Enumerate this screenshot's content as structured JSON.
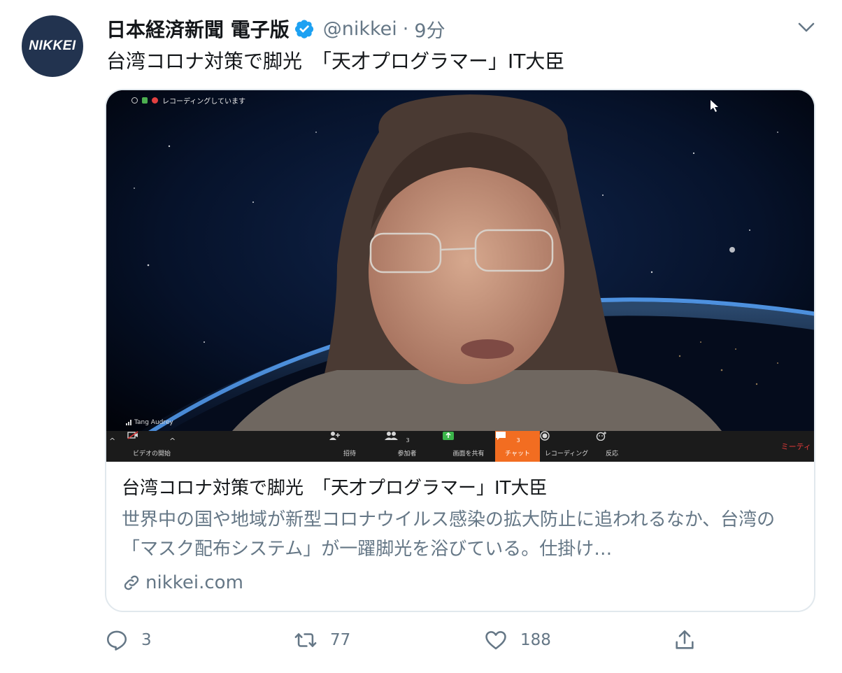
{
  "tweet": {
    "avatar_text": "NIKKEI",
    "display_name": "日本経済新聞 電子版",
    "handle": "@nikkei",
    "separator": "·",
    "time": "9分",
    "text": "台湾コロナ対策で脚光　「天才プログラマー」IT大臣"
  },
  "card": {
    "title": "台湾コロナ対策で脚光　「天才プログラマー」IT大臣",
    "description": "世界中の国や地域が新型コロナウイルス感染の拡大防止に追われるなか、台湾の「マスク配布システム」が一躍脚光を浴びている。仕掛け…",
    "domain": "nikkei.com",
    "media": {
      "recording_label": "レコーディングしています",
      "participant_name": "Tang Audrey",
      "toolbar": {
        "video": "ビデオの開始",
        "invite": "招待",
        "participants": "参加者",
        "participants_count": "3",
        "share": "画面を共有",
        "chat": "チャット",
        "chat_count": "3",
        "record": "レコーディング",
        "reactions": "反応",
        "end": "ミーティ"
      }
    }
  },
  "actions": {
    "reply_count": "3",
    "retweet_count": "77",
    "like_count": "188"
  },
  "colors": {
    "verified": "#1da1f2",
    "secondary_text": "#657786",
    "border": "#e1e8ed",
    "avatar_bg": "#22334f",
    "zoom_chat": "#f26d21"
  },
  "icons": [
    "verified-badge-icon",
    "caret-down-icon",
    "link-icon",
    "reply-icon",
    "retweet-icon",
    "like-icon",
    "share-icon"
  ]
}
